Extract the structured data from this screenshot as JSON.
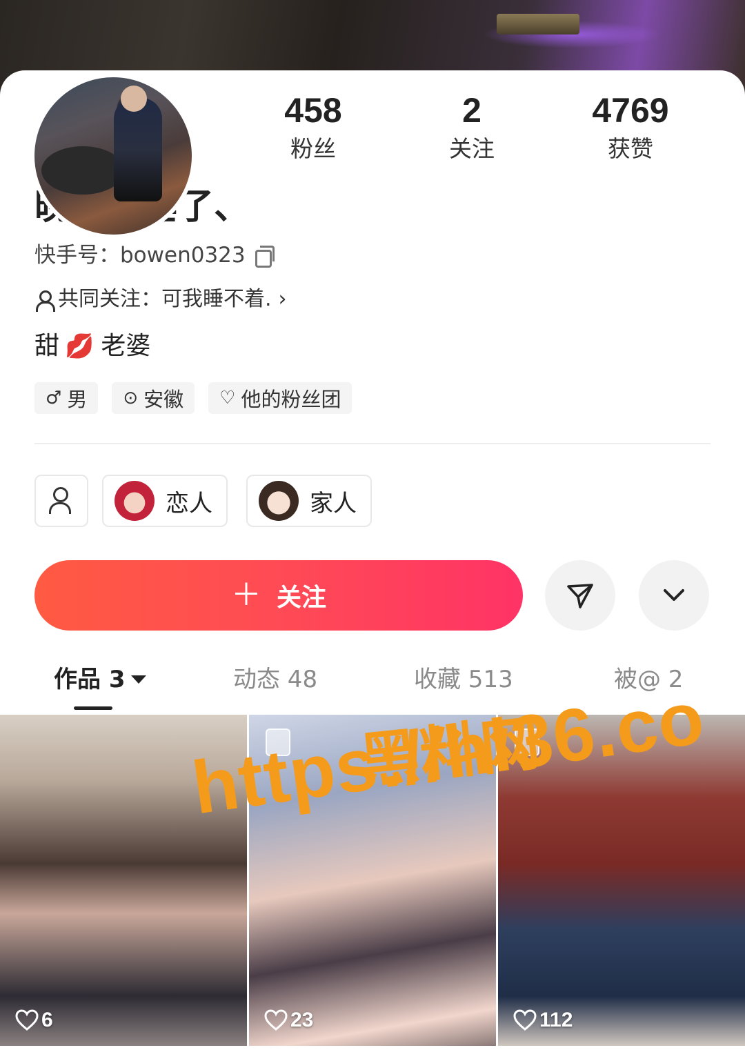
{
  "profile": {
    "stats": [
      {
        "value": "458",
        "label": "粉丝"
      },
      {
        "value": "2",
        "label": "关注"
      },
      {
        "value": "4769",
        "label": "获赞"
      }
    ],
    "nickname": "晚安要睡了、",
    "kuaishou_id": "快手号：bowen0323",
    "mutual_follow": "共同关注：可我睡不着.",
    "bio_prefix": "甜",
    "bio_emoji": "💋",
    "bio_suffix": "老婆",
    "tags": [
      {
        "icon": "male-icon",
        "glyph": "♂",
        "label": "男"
      },
      {
        "icon": "location-icon",
        "glyph": "⊙",
        "label": "安徽"
      },
      {
        "icon": "fan-club-icon",
        "glyph": "♡",
        "label": "他的粉丝团"
      }
    ]
  },
  "relations": [
    {
      "label": "恋人"
    },
    {
      "label": "家人"
    }
  ],
  "actions": {
    "follow_plus": "＋",
    "follow_label": "关注"
  },
  "tabs": [
    {
      "label": "作品 3",
      "active": true
    },
    {
      "label": "动态 48",
      "active": false
    },
    {
      "label": "收藏 513",
      "active": false
    },
    {
      "label": "被@ 2",
      "active": false
    }
  ],
  "posts": [
    {
      "likes": "6"
    },
    {
      "likes": "23"
    },
    {
      "likes": "112"
    }
  ],
  "watermark": {
    "line1": "黑料网",
    "line2": "https://hl36.co"
  },
  "colors": {
    "follow_gradient_start": "#ff5a42",
    "follow_gradient_end": "#ff3366",
    "watermark": "#f59b1c"
  }
}
